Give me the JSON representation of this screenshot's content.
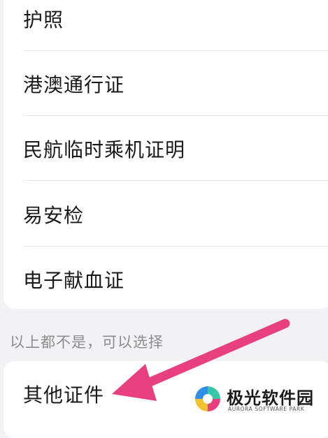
{
  "id_types": [
    {
      "label": "护照"
    },
    {
      "label": "港澳通行证"
    },
    {
      "label": "民航临时乘机证明"
    },
    {
      "label": "易安检"
    },
    {
      "label": "电子献血证"
    }
  ],
  "hint": "以上都不是，可以选择",
  "other": {
    "label": "其他证件"
  },
  "annotation": {
    "arrow_color": "#e8407f"
  },
  "watermark": {
    "title": "极光软件园",
    "subtitle": "AURORA SOFTWARE PARK",
    "colors": [
      "#2f8fe8",
      "#38c7a6",
      "#f2c230",
      "#e8407f"
    ]
  }
}
